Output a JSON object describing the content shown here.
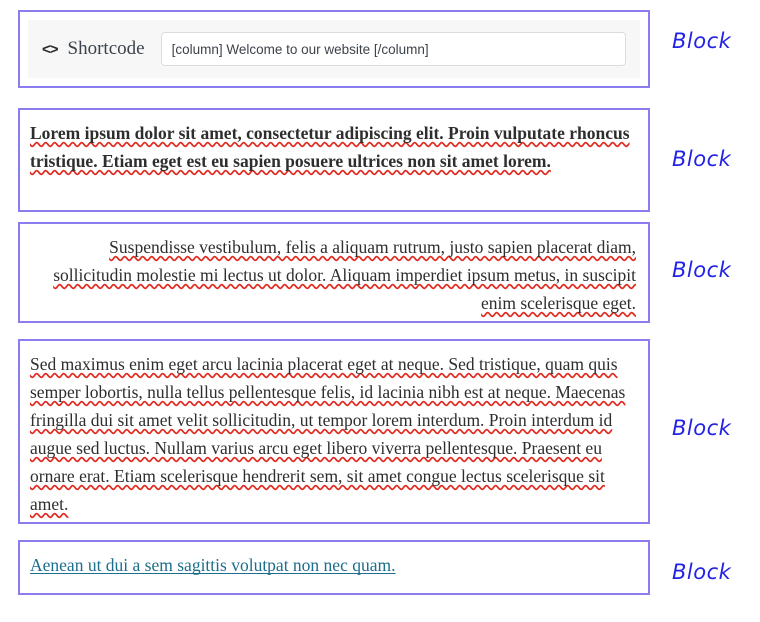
{
  "theme": {
    "block_border_color": "#8b7cf0",
    "annotation_color": "#2323e6",
    "link_color": "#1b6e8c",
    "spellcheck_underline_color": "#e02b20",
    "panel_background": "#f7f7f7"
  },
  "shortcode_block": {
    "icon": "code-brackets-icon",
    "icon_glyph": "<>",
    "label": "Shortcode",
    "input_value": "[column] Welcome to our website [/column]",
    "input_placeholder": "Write shortcode here…"
  },
  "paragraphs": [
    {
      "id": "paragraph-1",
      "align": "left",
      "bold": true,
      "text": "Lorem ipsum dolor sit amet, consectetur adipiscing elit. Proin vulputate rhoncus tristique. Etiam eget est eu sapien posuere ultrices non sit amet lorem."
    },
    {
      "id": "paragraph-2",
      "align": "right",
      "bold": false,
      "text": "Suspendisse vestibulum, felis a aliquam rutrum, justo sapien placerat diam, sollicitudin molestie mi lectus ut dolor. Aliquam imperdiet ipsum metus, in suscipit enim scelerisque eget."
    },
    {
      "id": "paragraph-3",
      "align": "left",
      "bold": false,
      "text": "Sed maximus enim eget arcu lacinia placerat eget at neque. Sed tristique, quam quis semper lobortis, nulla tellus pellentesque felis, id lacinia nibh est at neque. Maecenas fringilla dui sit amet velit sollicitudin, ut tempor lorem interdum. Proin interdum id augue sed luctus. Nullam varius arcu eget libero viverra pellentesque. Praesent eu ornare erat. Etiam scelerisque hendrerit sem, sit amet congue lectus scelerisque sit amet."
    }
  ],
  "link_block": {
    "id": "paragraph-4",
    "link_text": "Aenean ut dui a sem sagittis volutpat non nec quam."
  },
  "annotations": {
    "block_1": "Block",
    "block_2": "Block",
    "block_3": "Block",
    "block_4": "Block",
    "block_5": "Block"
  }
}
